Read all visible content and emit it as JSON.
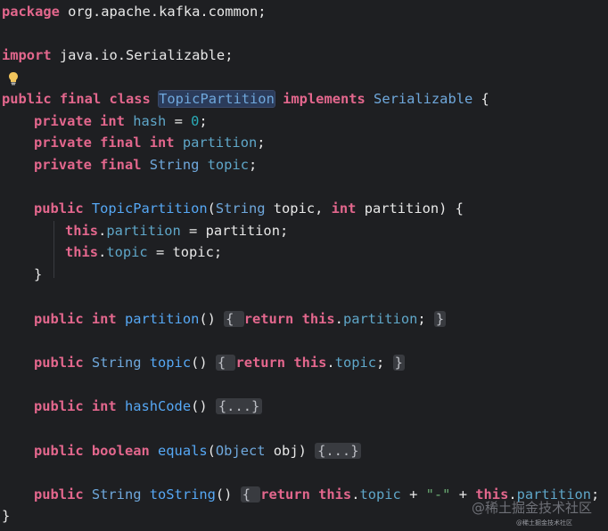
{
  "editor": {
    "lines": {
      "l1": {
        "kw": "package",
        "rest": " org.apache.kafka.common;"
      },
      "l3": {
        "kw": "import",
        "rest": " java.io.Serializable;"
      },
      "l5": {
        "kw1": "public",
        "kw2": " final",
        "kw3": " class",
        "space": " ",
        "classname": "TopicPartition",
        "impl": " implements",
        "iface": " Serializable",
        "brace": " {"
      },
      "l6": {
        "kw1": "private",
        "kw2": " int",
        "field": " hash",
        "eq": " = ",
        "num": "0",
        "semi": ";"
      },
      "l7": {
        "kw1": "private",
        "kw2": " final",
        "kw3": " int",
        "field": " partition",
        "semi": ";"
      },
      "l8": {
        "kw1": "private",
        "kw2": " final",
        "type": " String",
        "field": " topic",
        "semi": ";"
      },
      "l10": {
        "kw1": "public",
        "fn": " TopicPartition",
        "open": "(",
        "type1": "String",
        "p1": " topic, ",
        "kw2": "int",
        "p2": " partition) {"
      },
      "l11": {
        "kw": "this",
        "dot": ".",
        "field": "partition",
        "rest": " = partition;"
      },
      "l12": {
        "kw": "this",
        "dot": ".",
        "field": "topic",
        "rest": " = topic;"
      },
      "l13": {
        "brace": "}"
      },
      "l15": {
        "kw1": "public",
        "kw2": " int",
        "fn": " partition",
        "paren": "() ",
        "ob": "{ ",
        "ret": "return",
        "this": " this",
        "dot": ".",
        "field": "partition",
        "semi": "; ",
        "cb": "}"
      },
      "l17": {
        "kw1": "public",
        "type": " String",
        "fn": " topic",
        "paren": "() ",
        "ob": "{ ",
        "ret": "return",
        "this": " this",
        "dot": ".",
        "field": "topic",
        "semi": "; ",
        "cb": "}"
      },
      "l19": {
        "kw1": "public",
        "kw2": " int",
        "fn": " hashCode",
        "paren": "() ",
        "folded": "{...}"
      },
      "l21": {
        "kw1": "public",
        "kw2": " boolean",
        "fn": " equals",
        "open": "(",
        "type": "Object",
        "rest": " obj) ",
        "folded": "{...}"
      },
      "l23": {
        "kw1": "public",
        "type": " String",
        "fn": " toString",
        "paren": "() ",
        "ob": "{ ",
        "ret": "return",
        "this1": " this",
        "dot1": ".",
        "field1": "topic",
        "plus1": " + ",
        "str": "\"-\"",
        "plus2": " + ",
        "this2": "this",
        "dot2": ".",
        "field2": "partition",
        "semi": "; ",
        "cb": "}"
      },
      "l24": {
        "brace": "}"
      }
    },
    "intention_icon": "lightbulb-icon"
  },
  "watermark": {
    "text": "@稀土掘金技术社区",
    "small": "@稀土掘金技术社区"
  }
}
